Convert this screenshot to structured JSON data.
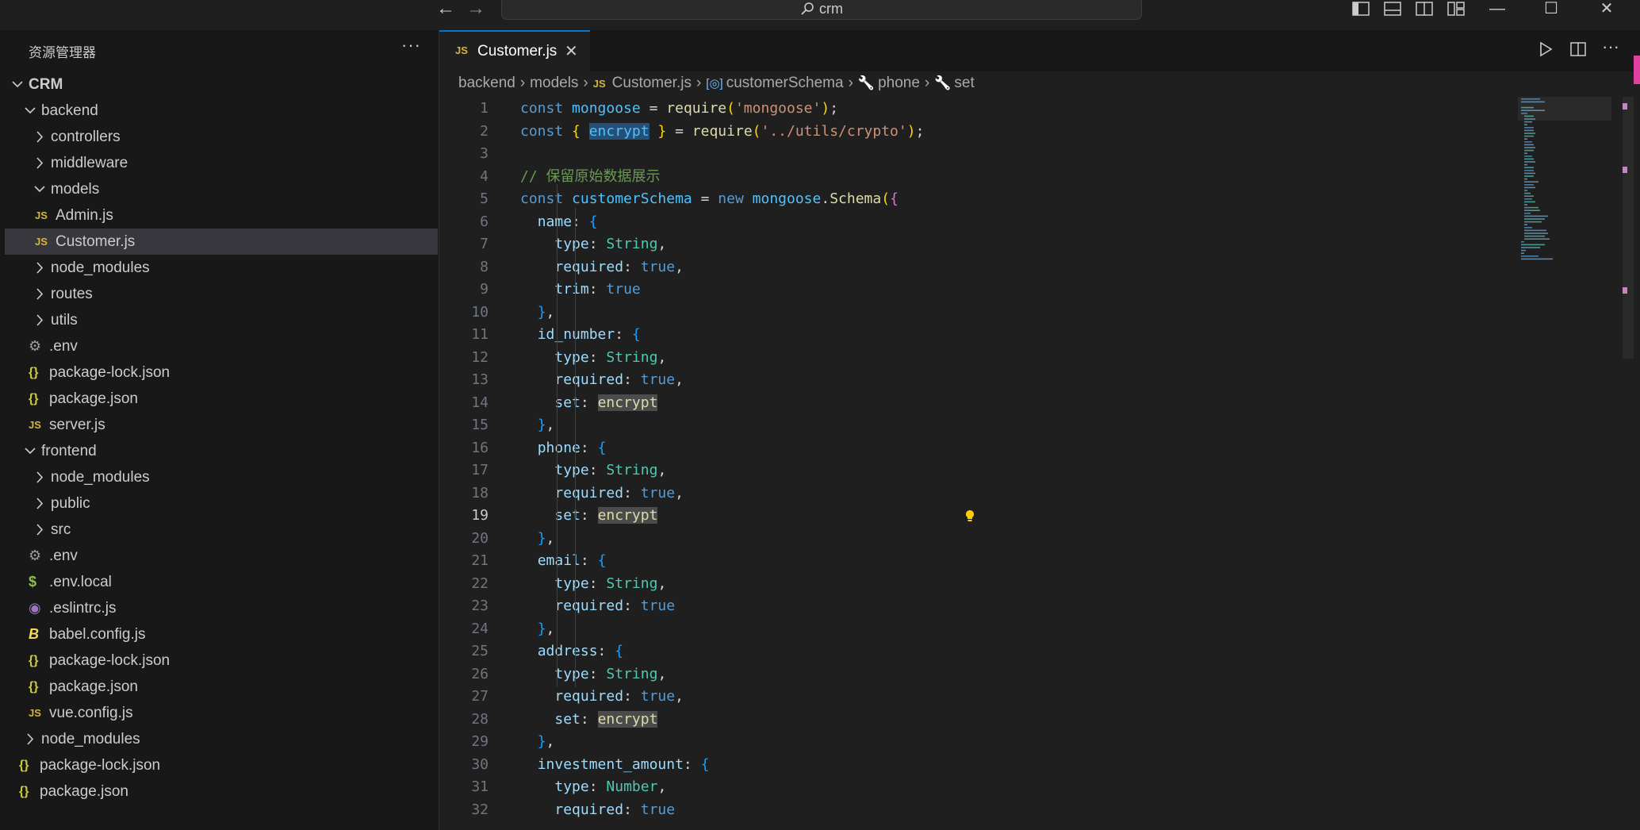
{
  "titlebar": {
    "search_text": "crm",
    "icons": [
      "arrow-left-icon",
      "arrow-right-icon",
      "search-icon",
      "toggle-primary-sidebar-icon",
      "toggle-panel-icon",
      "toggle-secondary-sidebar-icon",
      "customize-layout-icon",
      "minimize-icon",
      "maximize-icon",
      "close-icon"
    ]
  },
  "sidebar": {
    "title": "资源管理器",
    "more": "···",
    "tree": [
      {
        "label": "CRM",
        "type": "root",
        "depth": 0,
        "expanded": true
      },
      {
        "label": "backend",
        "type": "folder",
        "depth": 1,
        "expanded": true
      },
      {
        "label": "controllers",
        "type": "folder",
        "depth": 2,
        "expanded": false
      },
      {
        "label": "middleware",
        "type": "folder",
        "depth": 2,
        "expanded": false
      },
      {
        "label": "models",
        "type": "folder",
        "depth": 2,
        "expanded": true
      },
      {
        "label": "Admin.js",
        "type": "js",
        "depth": 3
      },
      {
        "label": "Customer.js",
        "type": "js",
        "depth": 3,
        "selected": true
      },
      {
        "label": "node_modules",
        "type": "folder",
        "depth": 2,
        "expanded": false
      },
      {
        "label": "routes",
        "type": "folder",
        "depth": 2,
        "expanded": false
      },
      {
        "label": "utils",
        "type": "folder",
        "depth": 2,
        "expanded": false
      },
      {
        "label": ".env",
        "type": "gear",
        "depth": 2
      },
      {
        "label": "package-lock.json",
        "type": "json",
        "depth": 2
      },
      {
        "label": "package.json",
        "type": "json",
        "depth": 2
      },
      {
        "label": "server.js",
        "type": "js",
        "depth": 2
      },
      {
        "label": "frontend",
        "type": "folder",
        "depth": 1,
        "expanded": true
      },
      {
        "label": "node_modules",
        "type": "folder",
        "depth": 2,
        "expanded": false
      },
      {
        "label": "public",
        "type": "folder",
        "depth": 2,
        "expanded": false
      },
      {
        "label": "src",
        "type": "folder",
        "depth": 2,
        "expanded": false
      },
      {
        "label": ".env",
        "type": "gear",
        "depth": 2
      },
      {
        "label": ".env.local",
        "type": "dollar",
        "depth": 2
      },
      {
        "label": ".eslintrc.js",
        "type": "eslint",
        "depth": 2
      },
      {
        "label": "babel.config.js",
        "type": "babel",
        "depth": 2
      },
      {
        "label": "package-lock.json",
        "type": "json",
        "depth": 2
      },
      {
        "label": "package.json",
        "type": "json",
        "depth": 2
      },
      {
        "label": "vue.config.js",
        "type": "js",
        "depth": 2
      },
      {
        "label": "node_modules",
        "type": "folder",
        "depth": 1,
        "expanded": false
      },
      {
        "label": "package-lock.json",
        "type": "json",
        "depth": 1
      },
      {
        "label": "package.json",
        "type": "json",
        "depth": 1
      }
    ]
  },
  "editor": {
    "tab": {
      "icon": "JS",
      "label": "Customer.js",
      "close": "✕"
    },
    "breadcrumb": [
      {
        "label": "backend",
        "icon": ""
      },
      {
        "label": "models",
        "icon": ""
      },
      {
        "label": "Customer.js",
        "icon": "JS"
      },
      {
        "label": "customerSchema",
        "icon": "symbol-variable-icon"
      },
      {
        "label": "phone",
        "icon": "wrench-icon"
      },
      {
        "label": "set",
        "icon": "wrench-icon"
      }
    ],
    "current_line": 19,
    "lines": [
      {
        "n": "1",
        "code": "const mongoose = require('mongoose');"
      },
      {
        "n": "2",
        "code": "const { encrypt } = require('../utils/crypto');"
      },
      {
        "n": "3",
        "code": ""
      },
      {
        "n": "4",
        "code": "// 保留原始数据展示"
      },
      {
        "n": "5",
        "code": "const customerSchema = new mongoose.Schema({"
      },
      {
        "n": "6",
        "code": "  name: {"
      },
      {
        "n": "7",
        "code": "    type: String,"
      },
      {
        "n": "8",
        "code": "    required: true,"
      },
      {
        "n": "9",
        "code": "    trim: true"
      },
      {
        "n": "10",
        "code": "  },"
      },
      {
        "n": "11",
        "code": "  id_number: {"
      },
      {
        "n": "12",
        "code": "    type: String,"
      },
      {
        "n": "13",
        "code": "    required: true,"
      },
      {
        "n": "14",
        "code": "    set: encrypt"
      },
      {
        "n": "15",
        "code": "  },"
      },
      {
        "n": "16",
        "code": "  phone: {"
      },
      {
        "n": "17",
        "code": "    type: String,"
      },
      {
        "n": "18",
        "code": "    required: true,"
      },
      {
        "n": "19",
        "code": "    set: encrypt"
      },
      {
        "n": "20",
        "code": "  },"
      },
      {
        "n": "21",
        "code": "  email: {"
      },
      {
        "n": "22",
        "code": "    type: String,"
      },
      {
        "n": "23",
        "code": "    required: true"
      },
      {
        "n": "24",
        "code": "  },"
      },
      {
        "n": "25",
        "code": "  address: {"
      },
      {
        "n": "26",
        "code": "    type: String,"
      },
      {
        "n": "27",
        "code": "    required: true,"
      },
      {
        "n": "28",
        "code": "    set: encrypt"
      },
      {
        "n": "29",
        "code": "  },"
      },
      {
        "n": "30",
        "code": "  investment_amount: {"
      },
      {
        "n": "31",
        "code": "    type: Number,"
      },
      {
        "n": "32",
        "code": "    required: true"
      }
    ]
  },
  "colors": {
    "accent": "#0078d4",
    "keyword": "#569cd6",
    "string": "#ce9178",
    "comment": "#6a9955"
  }
}
